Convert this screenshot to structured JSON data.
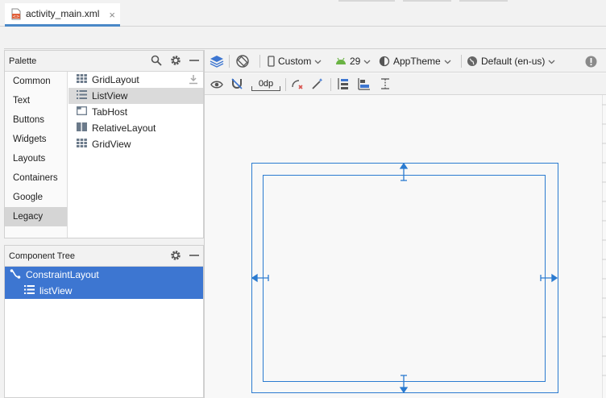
{
  "editor_tab": {
    "filename": "activity_main.xml",
    "close_glyph": "×"
  },
  "palette": {
    "title": "Palette",
    "categories": [
      "Common",
      "Text",
      "Buttons",
      "Widgets",
      "Layouts",
      "Containers",
      "Google",
      "Legacy"
    ],
    "selected_category": "Legacy",
    "widgets": [
      {
        "label": "GridLayout",
        "icon": "grid-icon"
      },
      {
        "label": "ListView",
        "icon": "list-icon",
        "selected": true
      },
      {
        "label": "TabHost",
        "icon": "tab-icon"
      },
      {
        "label": "RelativeLayout",
        "icon": "relative-layout-icon"
      },
      {
        "label": "GridView",
        "icon": "grid-icon"
      }
    ]
  },
  "component_tree": {
    "title": "Component Tree",
    "root": "ConstraintLayout",
    "child": "listView"
  },
  "design_toolbar": {
    "device": "Custom",
    "api": "29",
    "theme": "AppTheme",
    "locale": "Default (en-us)",
    "margin": "0dp"
  },
  "colors": {
    "accent": "#3d76d1",
    "blueprint": "#2b7bd0",
    "android_green": "#6ab344"
  }
}
